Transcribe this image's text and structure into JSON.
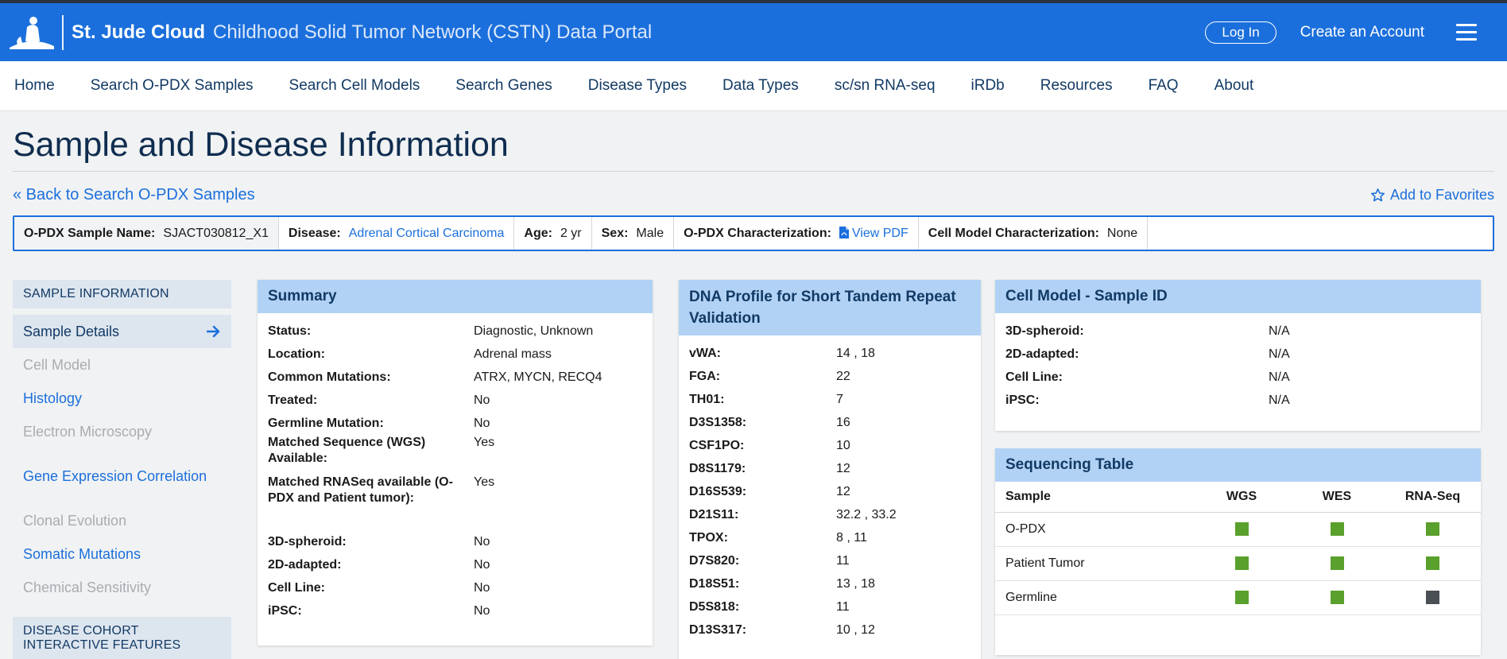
{
  "header": {
    "brand": "St. Jude Cloud",
    "portal_title": "Childhood Solid Tumor Network (CSTN) Data Portal",
    "login": "Log In",
    "create_account": "Create an Account"
  },
  "nav": [
    "Home",
    "Search O-PDX Samples",
    "Search Cell Models",
    "Search Genes",
    "Disease Types",
    "Data Types",
    "sc/sn RNA-seq",
    "iRDb",
    "Resources",
    "FAQ",
    "About"
  ],
  "page": {
    "title": "Sample and Disease Information",
    "back_link": "« Back to Search O-PDX Samples",
    "favorites": "Add to Favorites"
  },
  "infobar": {
    "sample_label": "O-PDX Sample Name:",
    "sample_value": "SJACT030812_X1",
    "disease_label": "Disease:",
    "disease_value": "Adrenal Cortical Carcinoma",
    "age_label": "Age:",
    "age_value": "2 yr",
    "sex_label": "Sex:",
    "sex_value": "Male",
    "opdx_char_label": "O-PDX Characterization:",
    "opdx_char_value": "View PDF",
    "cell_char_label": "Cell Model Characterization:",
    "cell_char_value": "None"
  },
  "sidebar": {
    "section1": "SAMPLE INFORMATION",
    "items": [
      {
        "label": "Sample Details",
        "state": "active"
      },
      {
        "label": "Cell Model",
        "state": "disabled"
      },
      {
        "label": "Histology",
        "state": "link"
      },
      {
        "label": "Electron Microscopy",
        "state": "disabled"
      },
      {
        "label": "Gene Expression Correlation",
        "state": "link"
      },
      {
        "label": "Clonal Evolution",
        "state": "disabled"
      },
      {
        "label": "Somatic Mutations",
        "state": "link"
      },
      {
        "label": "Chemical Sensitivity",
        "state": "disabled"
      }
    ],
    "section2": "DISEASE COHORT INTERACTIVE FEATURES"
  },
  "summary": {
    "title": "Summary",
    "rows": [
      {
        "k": "Status:",
        "v": "Diagnostic, Unknown"
      },
      {
        "k": "Location:",
        "v": "Adrenal mass"
      },
      {
        "k": "Common Mutations:",
        "v": "ATRX, MYCN, RECQ4"
      },
      {
        "k": "Treated:",
        "v": "No"
      },
      {
        "k": "Germline Mutation:",
        "v": "No"
      },
      {
        "k": "Matched Sequence (WGS) Available:",
        "v": "Yes"
      },
      {
        "k": "Matched RNASeq available (O-PDX and Patient tumor):",
        "v": "Yes"
      },
      {
        "k": "3D-spheroid:",
        "v": "No"
      },
      {
        "k": "2D-adapted:",
        "v": "No"
      },
      {
        "k": "Cell Line:",
        "v": "No"
      },
      {
        "k": "iPSC:",
        "v": "No"
      }
    ]
  },
  "dna": {
    "title": "DNA Profile for Short Tandem Repeat Validation",
    "rows": [
      {
        "k": "vWA:",
        "v": "14 , 18"
      },
      {
        "k": "FGA:",
        "v": "22"
      },
      {
        "k": "TH01:",
        "v": "7"
      },
      {
        "k": "D3S1358:",
        "v": "16"
      },
      {
        "k": "CSF1PO:",
        "v": "10"
      },
      {
        "k": "D8S1179:",
        "v": "12"
      },
      {
        "k": "D16S539:",
        "v": "12"
      },
      {
        "k": "D21S11:",
        "v": "32.2 , 33.2"
      },
      {
        "k": "TPOX:",
        "v": "8 , 11"
      },
      {
        "k": "D7S820:",
        "v": "11"
      },
      {
        "k": "D18S51:",
        "v": "13 , 18"
      },
      {
        "k": "D5S818:",
        "v": "11"
      },
      {
        "k": "D13S317:",
        "v": "10 , 12"
      }
    ]
  },
  "cellmodel": {
    "title": "Cell Model - Sample ID",
    "rows": [
      {
        "k": "3D-spheroid:",
        "v": "N/A"
      },
      {
        "k": "2D-adapted:",
        "v": "N/A"
      },
      {
        "k": "Cell Line:",
        "v": "N/A"
      },
      {
        "k": "iPSC:",
        "v": "N/A"
      }
    ]
  },
  "sequencing": {
    "title": "Sequencing Table",
    "columns": [
      "Sample",
      "WGS",
      "WES",
      "RNA-Seq"
    ],
    "rows": [
      {
        "sample": "O-PDX",
        "wgs": true,
        "wes": true,
        "rna": true
      },
      {
        "sample": "Patient Tumor",
        "wgs": true,
        "wes": true,
        "rna": true
      },
      {
        "sample": "Germline",
        "wgs": true,
        "wes": true,
        "rna": false
      }
    ],
    "available_color": "#5aa02c",
    "unavailable_color": "#4a4f55"
  },
  "colors": {
    "header_bg": "#1b6fdc",
    "panel_head": "#b1d2f5",
    "link": "#1b6fdc"
  }
}
